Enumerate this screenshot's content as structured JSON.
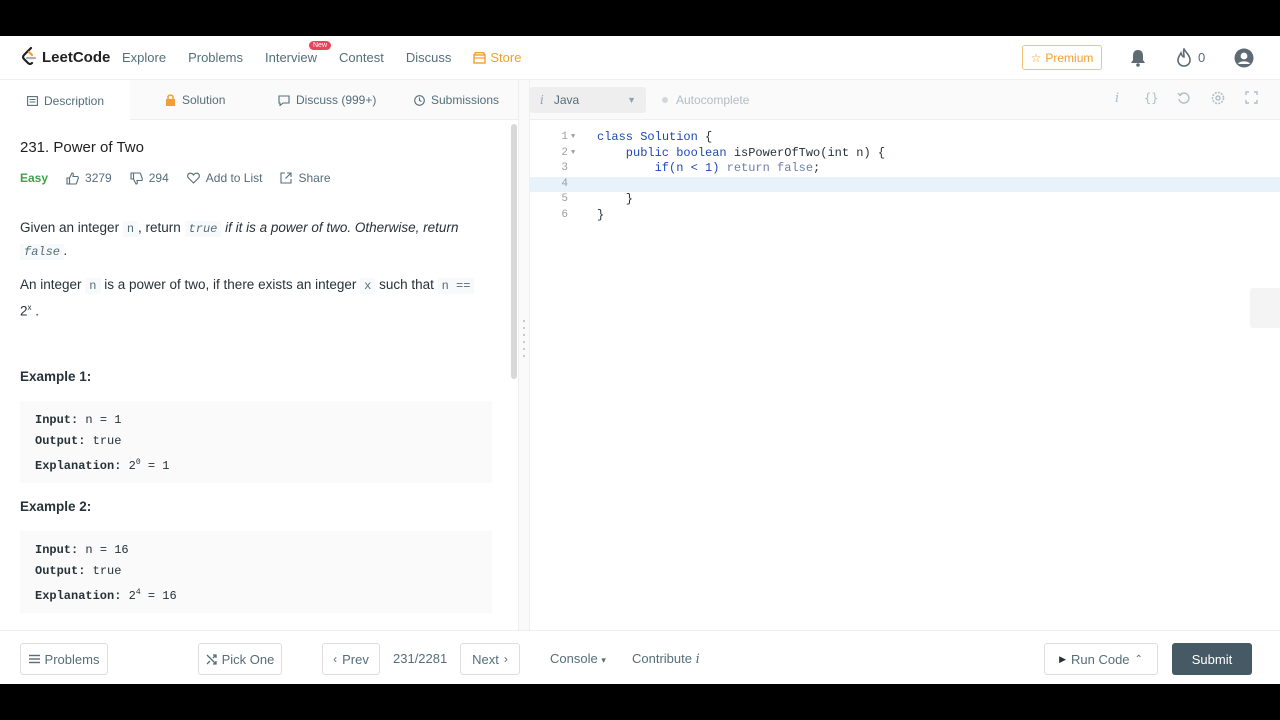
{
  "nav": {
    "brand": "LeetCode",
    "links": [
      "Explore",
      "Problems",
      "Interview",
      "Contest",
      "Discuss"
    ],
    "store": "Store",
    "new_badge": "New",
    "premium": "Premium",
    "streak": "0"
  },
  "tabs": {
    "description": "Description",
    "solution": "Solution",
    "discuss": "Discuss (999+)",
    "submissions": "Submissions"
  },
  "problem": {
    "title": "231. Power of Two",
    "difficulty": "Easy",
    "likes": "3279",
    "dislikes": "294",
    "add_to_list": "Add to List",
    "share": "Share",
    "p1": {
      "a": "Given an integer ",
      "n": "n",
      "b": ", return ",
      "true": "true",
      "c": " if it is a power of two. Otherwise, return",
      "false": "false",
      "d": "."
    },
    "p2": {
      "a": "An integer ",
      "n": "n",
      "b": " is a power of two, if there exists an integer ",
      "x": "x",
      "c": " such that ",
      "eq": "n ==",
      "base": "2",
      "exp": "x",
      "d": "."
    },
    "examples": [
      {
        "title": "Example 1:",
        "input_label": "Input:",
        "input": "n = 1",
        "output_label": "Output:",
        "output": "true",
        "expl_label": "Explanation:",
        "expl_base": "2",
        "expl_exp": "0",
        "expl_rest": "= 1"
      },
      {
        "title": "Example 2:",
        "input_label": "Input:",
        "input": "n = 16",
        "output_label": "Output:",
        "output": "true",
        "expl_label": "Explanation:",
        "expl_base": "2",
        "expl_exp": "4",
        "expl_rest": "= 16"
      }
    ]
  },
  "editor": {
    "language": "Java",
    "autocomplete": "Autocomplete",
    "lines": [
      {
        "num": "1",
        "fold": true
      },
      {
        "num": "2",
        "fold": true
      },
      {
        "num": "3",
        "fold": false
      },
      {
        "num": "4",
        "fold": false
      },
      {
        "num": "5",
        "fold": false
      },
      {
        "num": "6",
        "fold": false
      }
    ],
    "code": {
      "l1a": "class ",
      "l1b": "Solution",
      "l1c": " {",
      "l2a": "    public boolean ",
      "l2b": "isPowerOfTwo",
      "l2c": "(int n) {",
      "l3a": "        if(n < 1) ",
      "l3b": "return false",
      "l3c": ";",
      "l4": "",
      "l5": "    }",
      "l6": "}"
    }
  },
  "bottom": {
    "problems": "Problems",
    "pick_one": "Pick One",
    "prev": "Prev",
    "counter": "231/2281",
    "next": "Next",
    "console": "Console",
    "contribute": "Contribute",
    "run_code": "Run Code",
    "submit": "Submit"
  },
  "colors": {
    "accent": "#f0a02c",
    "easy": "#43a047",
    "submit_bg": "#455a64",
    "keyword": "#1f49b8"
  }
}
